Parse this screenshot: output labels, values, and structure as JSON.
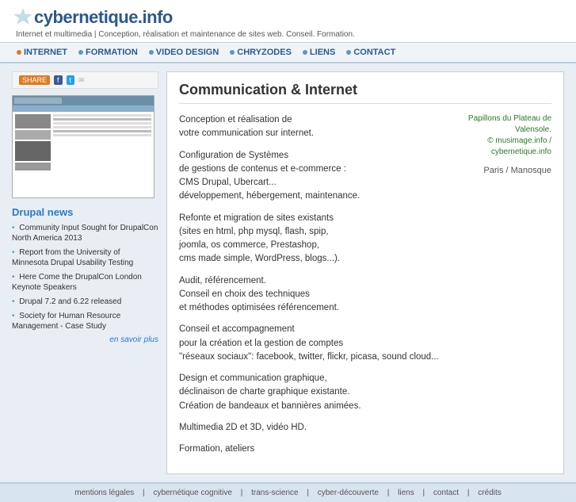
{
  "site": {
    "logo_text": "cybernetique.info",
    "tagline": "Internet et multimedia | Conception, réalisation et maintenance de sites web. Conseil. Formation."
  },
  "nav": {
    "items": [
      {
        "label": "INTERNET",
        "dot_color": "orange"
      },
      {
        "label": "FORMATION",
        "dot_color": "blue"
      },
      {
        "label": "VIDEO DESIGN",
        "dot_color": "blue"
      },
      {
        "label": "CHRYZODES",
        "dot_color": "blue"
      },
      {
        "label": "LIENS",
        "dot_color": "blue"
      },
      {
        "label": "CONTACT",
        "dot_color": "blue"
      }
    ]
  },
  "share": {
    "label": "SHARE",
    "fb": "f",
    "tw": "t"
  },
  "drupal_news": {
    "title": "Drupal news",
    "items": [
      "Community Input Sought for DrupalCon North America 2013",
      "Report from the University of Minnesota Drupal Usability Testing",
      "Here Come the DrupalCon London Keynote Speakers",
      "Drupal 7.2 and 6.22 released",
      "Society for Human Resource Management - Case Study"
    ],
    "more_link": "en savoir plus"
  },
  "content": {
    "title": "Communication & Internet",
    "sections": [
      "Conception et réalisation de\nvotre communication sur internet.",
      "Configuration de Systèmes\nde gestions de contenus et e-commerce :\nCMS Drupal, Ubercart...\ndéveloppement, hébergement, maintenance.",
      "Refonte et migration de sites existants\n(sites en html, php mysql, flash, spip,\njoomla, os commerce, Prestashop,\ncms made simple, WordPress, blogs...).",
      "Audit, référencement.\nConseil en choix des techniques\net méthodes optimisées référencement.",
      "Conseil et accompagnement\npour la création et la gestion de comptes\n\"réseaux sociaux\": facebook, twitter, flickr, picasa, sound cloud...",
      "Design et communication graphique,\ndéclinaison de charte graphique existante.\nCréation de bandeaux et bannières animées.",
      "Multimedia 2D et 3D, vidéo HD.",
      "Formation, ateliers"
    ]
  },
  "right_col": {
    "papillons_text": "Papillons du Plateau de Valensole.",
    "credit": "© musimage.info / cybernetique.info",
    "location": "Paris / Manosque"
  },
  "footer": {
    "links": [
      "mentions légales",
      "cybernétique cognitive",
      "trans-science",
      "cyber-découverte",
      "liens",
      "contact",
      "crédits"
    ]
  }
}
